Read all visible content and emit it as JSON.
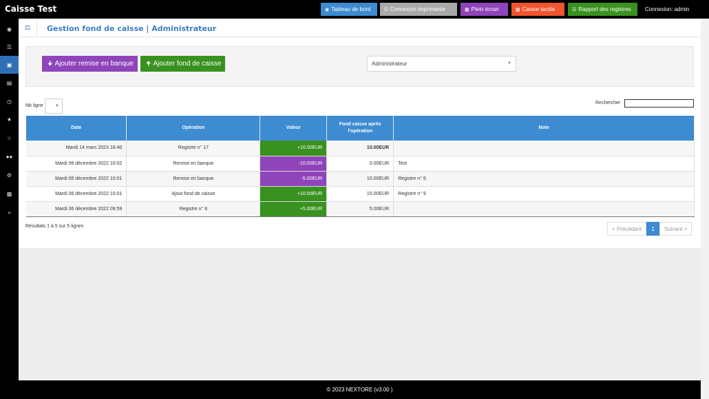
{
  "header": {
    "brand": "Caisse Test",
    "buttons": [
      {
        "label": "Tableau de bord",
        "icon": "dashboard-icon",
        "color": "#3d8bd1"
      },
      {
        "label": "Connexion imprimante",
        "icon": "print-icon",
        "color": "#a9a9a9"
      },
      {
        "label": "Plein écran",
        "icon": "grid-icon",
        "color": "#8f44ba"
      },
      {
        "label": "Caisse tactile",
        "icon": "grid-icon",
        "color": "#f2542d"
      },
      {
        "label": "Rapport des registres",
        "icon": "list-icon",
        "color": "#39911f"
      }
    ],
    "connexion": "Connexion: admin"
  },
  "sidebar": {
    "items": [
      "dashboard-icon",
      "list-icon",
      "cart-icon",
      "document-icon",
      "clock-icon",
      "star-icon",
      "star-outline-icon",
      "users-icon",
      "gear-icon",
      "chart-icon",
      "expand-icon"
    ],
    "active_index": 2
  },
  "page": {
    "title": "Gestion fond de caisse | Administrateur",
    "buttons": {
      "remise": "Ajouter remise en banque",
      "fond": "Ajouter fond de caisse"
    },
    "user_select": "Administrateur",
    "nb_ligne_label": "Nb ligne",
    "search_label": "Rechercher"
  },
  "table": {
    "columns": [
      "Date",
      "Opération",
      "Valeur",
      "Fond caisse après l'opération",
      "Note"
    ],
    "rows": [
      {
        "date": "Mardi 14 mars 2023 16:40",
        "op": "Registre n° 17",
        "val": "+10.00EUR",
        "sign": "pos",
        "fond": "10.00EUR",
        "note": ""
      },
      {
        "date": "Mardi 06 décembre 2022 10:02",
        "op": "Remise en banque",
        "val": "-10.00EUR",
        "sign": "neg",
        "fond": "0.00EUR",
        "note": "Test"
      },
      {
        "date": "Mardi 06 décembre 2022 10:01",
        "op": "Remise en banque",
        "val": "-5.00EUR",
        "sign": "neg",
        "fond": "10.00EUR",
        "note": "Registre n° 9"
      },
      {
        "date": "Mardi 06 décembre 2022 10:01",
        "op": "Ajout fond de caisse",
        "val": "+10.00EUR",
        "sign": "pos",
        "fond": "15.00EUR",
        "note": "Registre n° 9"
      },
      {
        "date": "Mardi 06 décembre 2022 09:59",
        "op": "Registre n° 8",
        "val": "+5.00EUR",
        "sign": "pos",
        "fond": "5.00EUR",
        "note": ""
      }
    ],
    "results": "Résultats 1 à 5 sur 5 lignes"
  },
  "pager": {
    "prev": "< Précédent",
    "current": "1",
    "next": "Suivant >"
  },
  "footer": "© 2023 NEXTORE (v3.00 )"
}
